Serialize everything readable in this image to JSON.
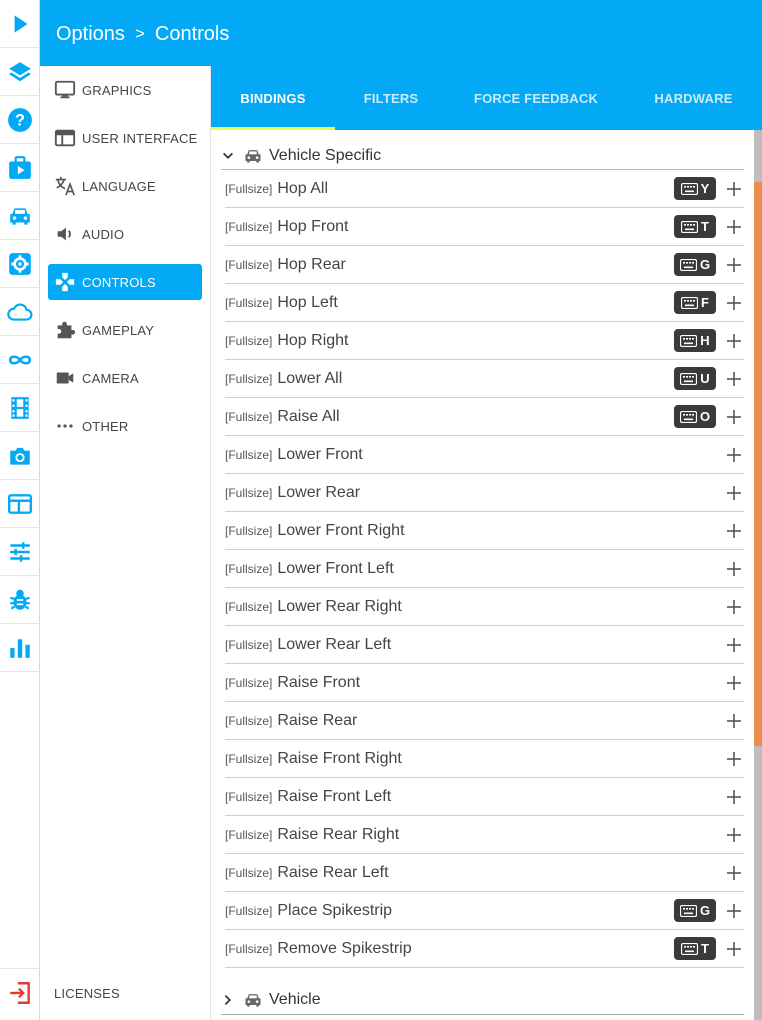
{
  "header": {
    "parent": "Options",
    "separator": ">",
    "current": "Controls"
  },
  "rail": {
    "icons": [
      "play-icon",
      "layers-icon",
      "help-icon",
      "briefcase-play-icon",
      "car-icon",
      "gear-icon",
      "cloud-icon",
      "infinity-icon",
      "film-icon",
      "camera-icon",
      "layout-icon",
      "sliders-icon",
      "bug-icon",
      "bar-chart-icon"
    ],
    "exit_icon": "exit-icon",
    "color": "#03a9f4",
    "exit_color": "#e53935"
  },
  "sidebar": {
    "items": [
      {
        "label": "GRAPHICS",
        "icon": "monitor-icon"
      },
      {
        "label": "USER INTERFACE",
        "icon": "window-icon"
      },
      {
        "label": "LANGUAGE",
        "icon": "translate-icon"
      },
      {
        "label": "AUDIO",
        "icon": "speaker-icon"
      },
      {
        "label": "CONTROLS",
        "icon": "gamepad-icon",
        "active": true
      },
      {
        "label": "GAMEPLAY",
        "icon": "puzzle-icon"
      },
      {
        "label": "CAMERA",
        "icon": "video-camera-icon"
      },
      {
        "label": "OTHER",
        "icon": "more-icon"
      }
    ],
    "footer": "LICENSES"
  },
  "tabs": {
    "items": [
      "BINDINGS",
      "FILTERS",
      "FORCE FEEDBACK",
      "HARDWARE"
    ],
    "active_index": 0,
    "bg": "#03a9f4",
    "indicator": "#e6ff52"
  },
  "bindings": {
    "category": "Vehicle Specific",
    "prefix": "[Fullsize]",
    "rows": [
      {
        "name": "Hop All",
        "key": "Y"
      },
      {
        "name": "Hop Front",
        "key": "T"
      },
      {
        "name": "Hop Rear",
        "key": "G"
      },
      {
        "name": "Hop Left",
        "key": "F"
      },
      {
        "name": "Hop Right",
        "key": "H"
      },
      {
        "name": "Lower All",
        "key": "U"
      },
      {
        "name": "Raise All",
        "key": "O"
      },
      {
        "name": "Lower Front",
        "key": ""
      },
      {
        "name": "Lower Rear",
        "key": ""
      },
      {
        "name": "Lower Front Right",
        "key": ""
      },
      {
        "name": "Lower Front Left",
        "key": ""
      },
      {
        "name": "Lower Rear Right",
        "key": ""
      },
      {
        "name": "Lower Rear Left",
        "key": ""
      },
      {
        "name": "Raise Front",
        "key": ""
      },
      {
        "name": "Raise Rear",
        "key": ""
      },
      {
        "name": "Raise Front Right",
        "key": ""
      },
      {
        "name": "Raise Front Left",
        "key": ""
      },
      {
        "name": "Raise Rear Right",
        "key": ""
      },
      {
        "name": "Raise Rear Left",
        "key": ""
      },
      {
        "name": "Place Spikestrip",
        "key": "G"
      },
      {
        "name": "Remove Spikestrip",
        "key": "T"
      }
    ],
    "next_category": "Vehicle"
  }
}
